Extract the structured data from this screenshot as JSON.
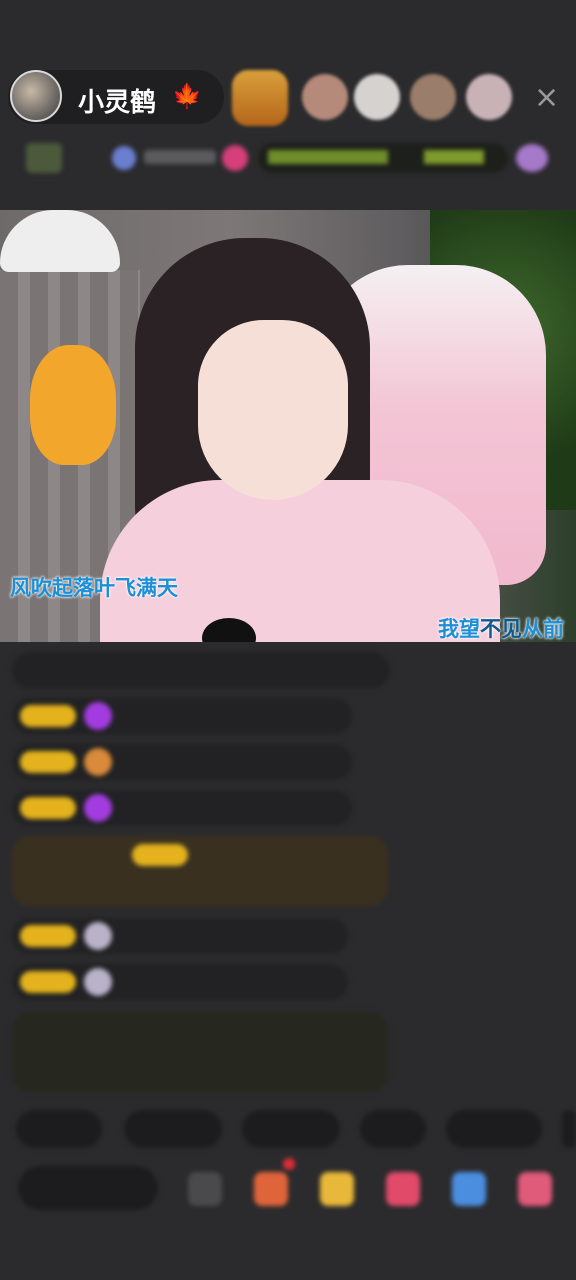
{
  "host": {
    "name": "小灵鹤",
    "leaf_icon": "maple-leaf-icon"
  },
  "viewers": [
    {
      "name": "viewer-1",
      "color": "#c98c3b"
    },
    {
      "name": "viewer-2",
      "color": "#b58a7a"
    },
    {
      "name": "viewer-3",
      "color": "#d6d2cf"
    },
    {
      "name": "viewer-4",
      "color": "#9a7d6a"
    },
    {
      "name": "viewer-5",
      "color": "#c9b2b6"
    }
  ],
  "close_icon": "×",
  "lyrics": {
    "left": "风吹起落叶飞满天",
    "right_part1": "我望",
    "right_part2": "不见",
    "right_part3": "从前"
  },
  "colors": {
    "accent_gold": "#e3b21d",
    "lyric_blue": "#1d8fd6",
    "background": "#2b2b2d"
  }
}
